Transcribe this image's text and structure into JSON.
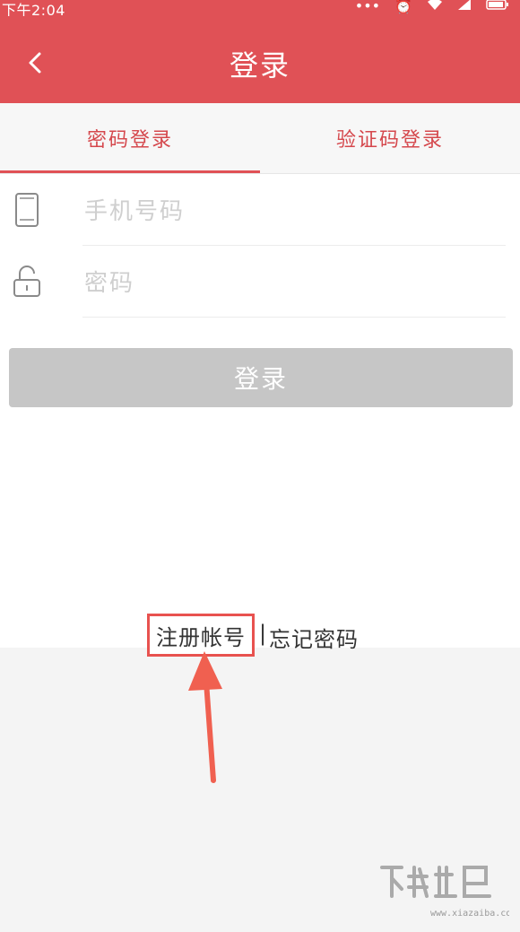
{
  "status_bar": {
    "time": "下午2:04",
    "icons": [
      "more-dots-icon",
      "alarm-icon",
      "wifi-icon",
      "signal-icon",
      "battery-icon"
    ]
  },
  "header": {
    "title": "登录",
    "back_icon": "chevron-left-icon",
    "background": "#e05156"
  },
  "tabs": [
    {
      "label": "密码登录",
      "active": true
    },
    {
      "label": "验证码登录",
      "active": false
    }
  ],
  "form": {
    "phone": {
      "placeholder": "手机号码",
      "value": "",
      "icon": "phone-icon"
    },
    "password": {
      "placeholder": "密码",
      "value": "",
      "icon": "lock-icon"
    }
  },
  "login_button": {
    "label": "登录",
    "color": "#c6c6c6"
  },
  "links": {
    "register": "注册帐号",
    "separator": "|",
    "forgot": "忘记密码",
    "highlight_color": "#e8524f"
  },
  "annotation": {
    "arrow_color": "#f06050"
  }
}
